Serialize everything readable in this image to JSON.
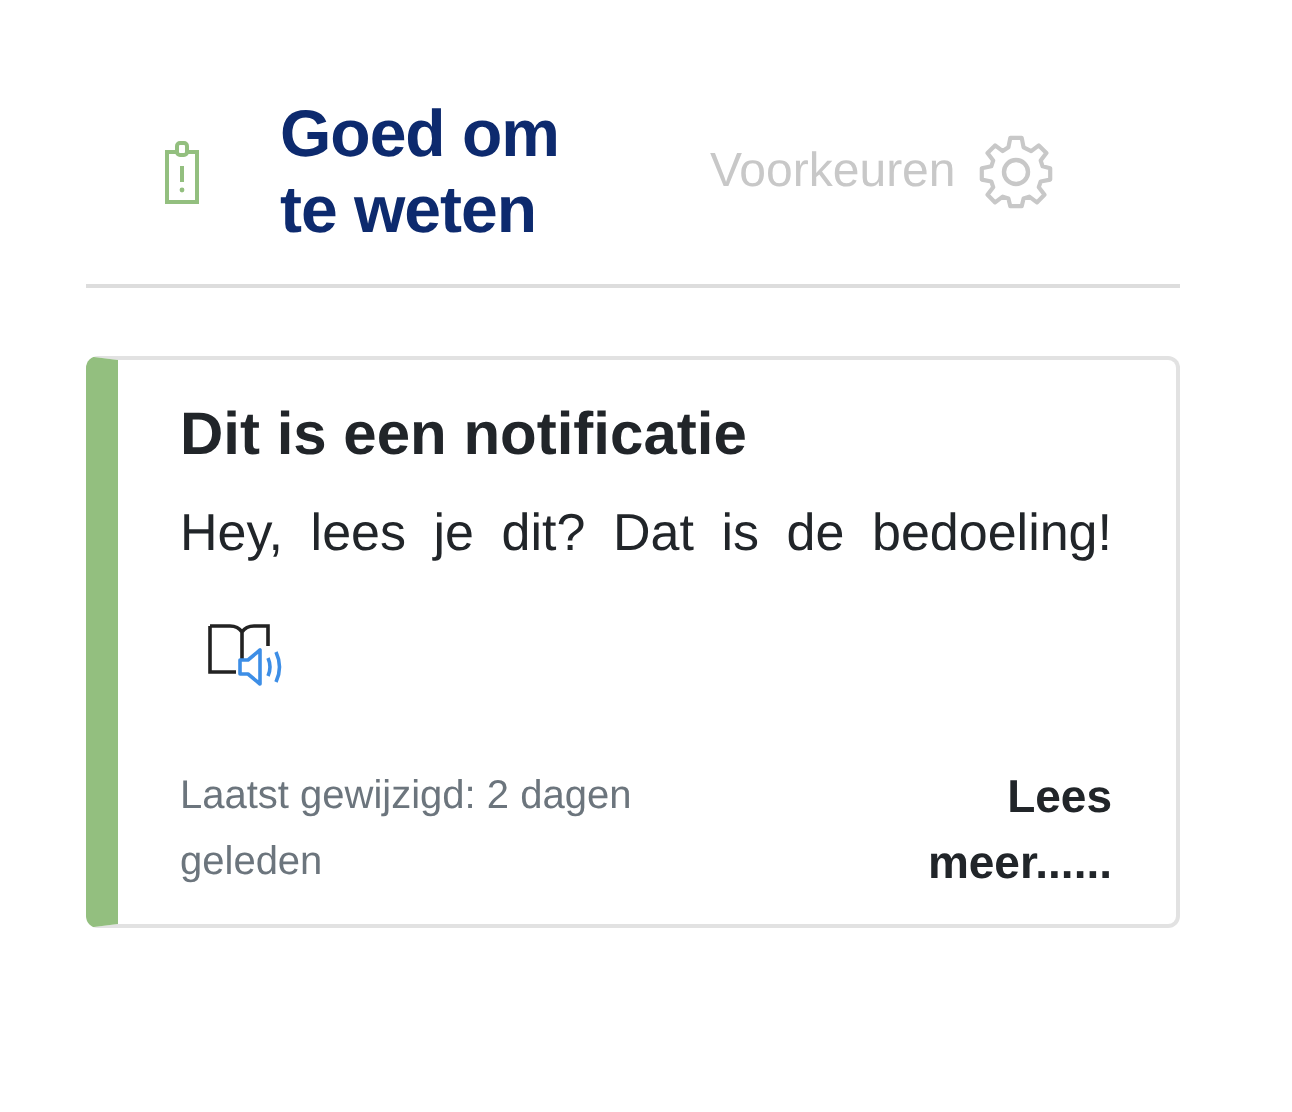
{
  "header": {
    "title": "Goed om te weten",
    "preferences_link": "Voorkeuren"
  },
  "notification": {
    "title": "Dit is een notificatie",
    "body": "Hey, lees je dit? Dat is de bedoeling!",
    "modified": "Laatst gewijzigd: 2 dagen geleden",
    "read_more": "Lees meer......"
  }
}
